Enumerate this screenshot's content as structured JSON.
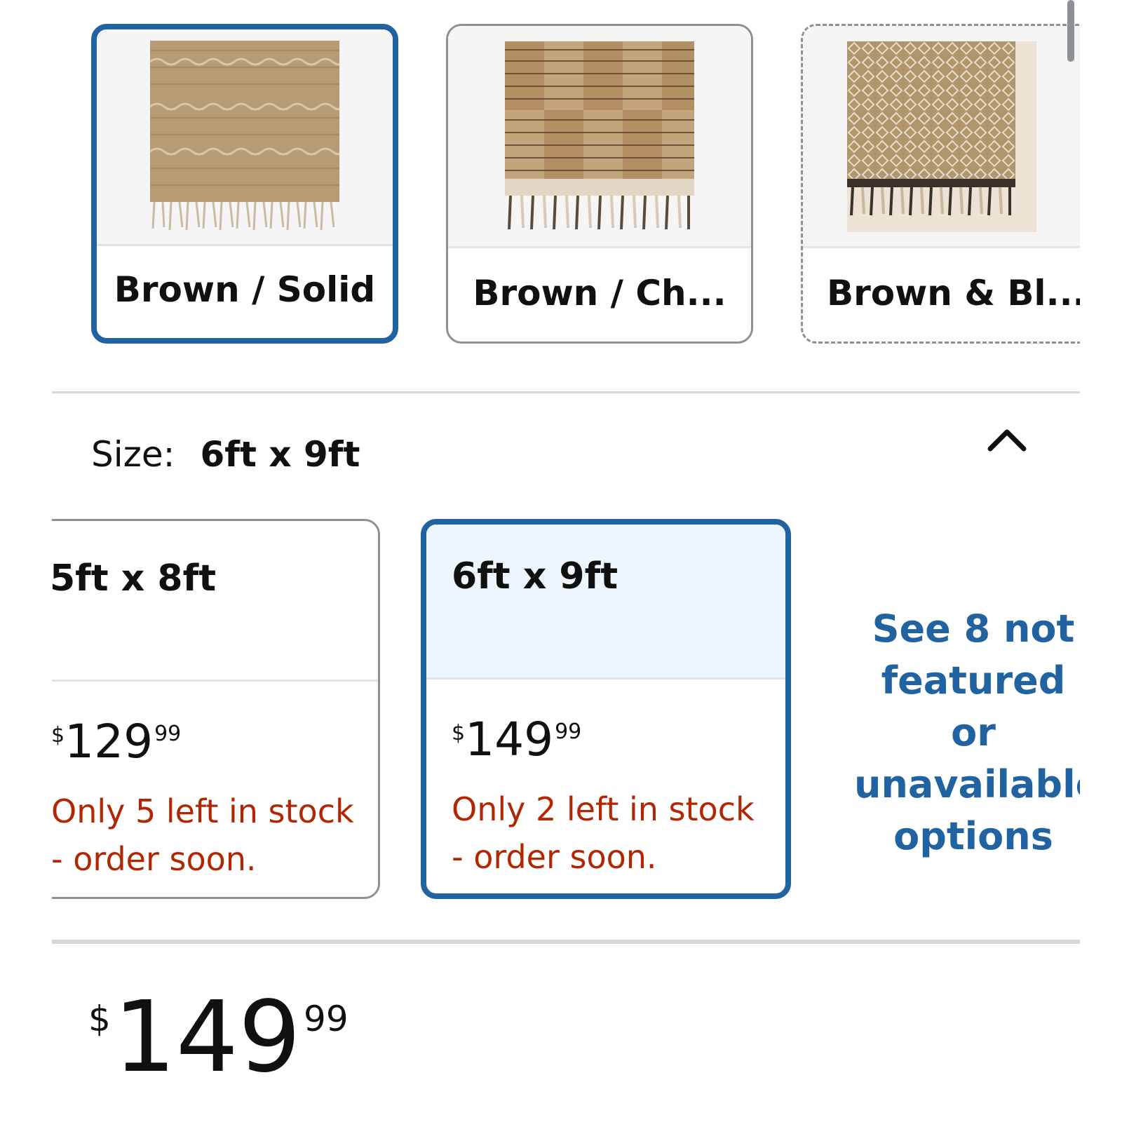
{
  "color_options": [
    {
      "label": "Brown / Solid",
      "selected": true
    },
    {
      "label": "Brown / Ch...",
      "selected": false
    },
    {
      "label": "Brown & Bl...",
      "selected": false
    }
  ],
  "size_header": {
    "key": "Size:",
    "value": "6ft x 9ft"
  },
  "size_options": [
    {
      "size": "5ft x 8ft",
      "currency": "$",
      "price_whole": "129",
      "price_fraction": "99",
      "stock_line1": "Only 5 left in stock",
      "stock_line2": "- order soon.",
      "selected": false
    },
    {
      "size": "6ft x 9ft",
      "currency": "$",
      "price_whole": "149",
      "price_fraction": "99",
      "stock_line1": "Only 2 left in stock",
      "stock_line2": "- order soon.",
      "selected": true
    }
  ],
  "see_more": {
    "line1": "See 8 not",
    "line2": "featured or",
    "line3": "unavailable",
    "line4": "options"
  },
  "final_price": {
    "currency": "$",
    "whole": "149",
    "fraction": "99"
  },
  "colors": {
    "selected_border": "#2162a1",
    "link": "#2162a1",
    "stock_warning": "#b12704",
    "selected_tile_bg": "#edf6fd"
  }
}
